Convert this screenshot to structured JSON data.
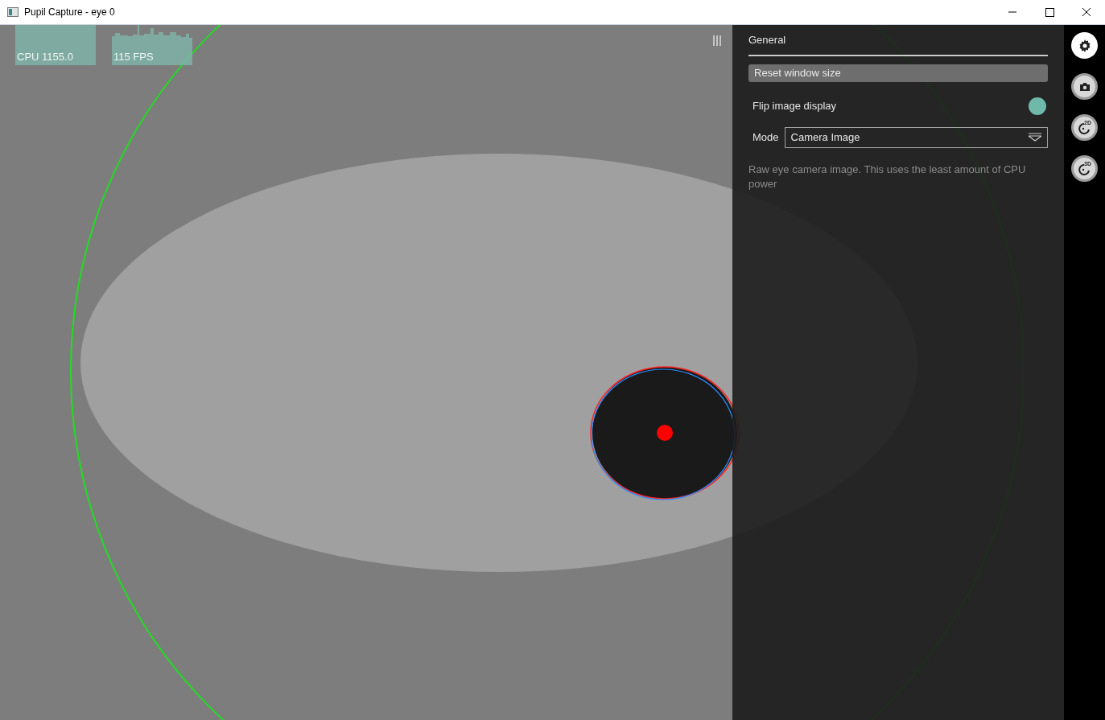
{
  "window": {
    "title": "Pupil Capture - eye 0"
  },
  "graphs": [
    {
      "kind": "block",
      "label": "CPU 1155.0"
    },
    {
      "kind": "sparkline",
      "label": "115 FPS"
    }
  ],
  "panel": {
    "title": "General",
    "button": "Reset window size",
    "toggle": {
      "label": "Flip image display",
      "on": true
    },
    "mode": {
      "label": "Mode",
      "value": "Camera Image"
    },
    "description": "Raw eye camera image. This uses the least amount of CPU power"
  },
  "sidebar": {
    "items": [
      {
        "kind": "settings",
        "selected": true
      },
      {
        "kind": "camera",
        "selected": false
      },
      {
        "kind": "detector",
        "badge": "2D",
        "selected": false
      },
      {
        "kind": "detector",
        "badge": "3D",
        "selected": false
      }
    ]
  }
}
